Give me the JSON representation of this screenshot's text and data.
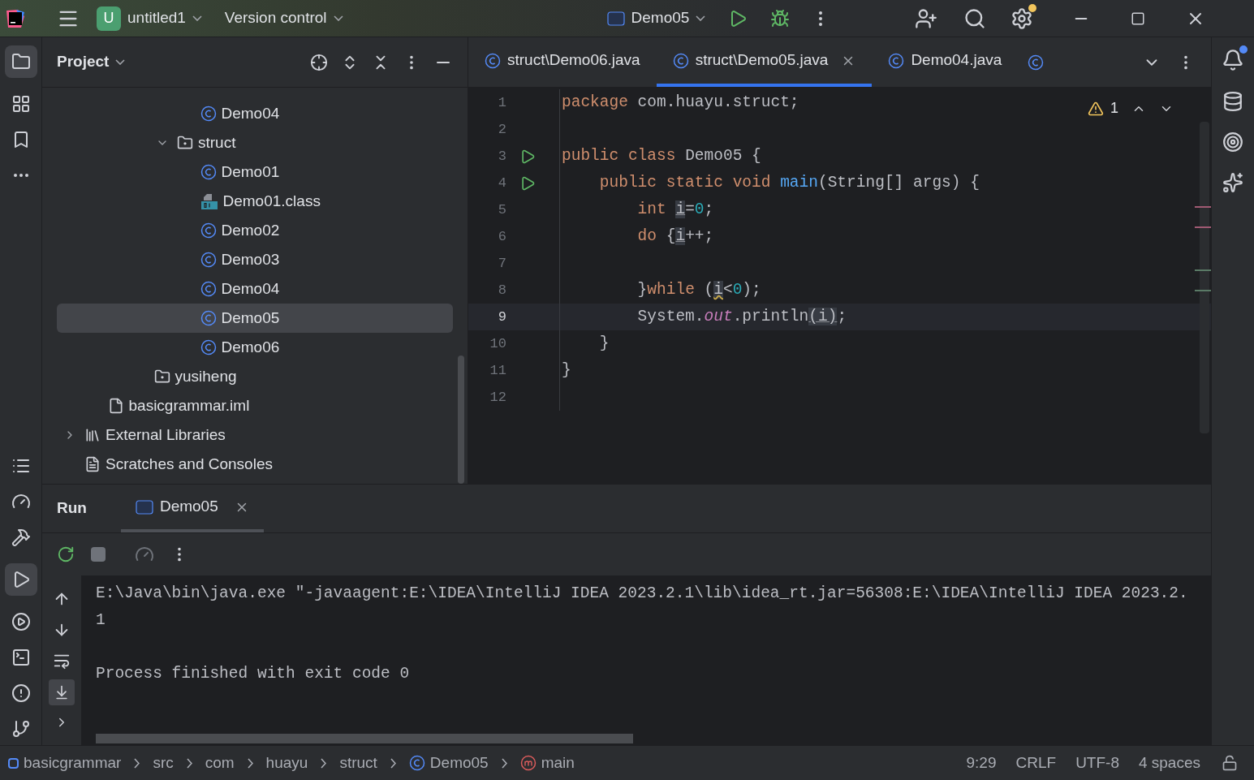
{
  "title_bar": {
    "project_badge": "U",
    "project": "untitled1",
    "vcs": "Version control",
    "run_config": "Demo05"
  },
  "project_panel": {
    "title": "Project",
    "tree": [
      {
        "children": [
          {
            "children": [
              {
                "children": [
                  {
                    "children": [
                      {
                        "children": [
                          {
                            "label": "Demo04",
                            "kind": "class",
                            "selected": false
                          }
                        ]
                      },
                      {
                        "label": "struct",
                        "kind": "package",
                        "expanded": true,
                        "children": [
                          {
                            "label": "Demo01",
                            "kind": "class",
                            "selected": false
                          },
                          {
                            "label": "Demo01.class",
                            "kind": "class-file",
                            "selected": false
                          },
                          {
                            "label": "Demo02",
                            "kind": "class",
                            "selected": false
                          },
                          {
                            "label": "Demo03",
                            "kind": "class",
                            "selected": false
                          },
                          {
                            "label": "Demo04",
                            "kind": "class",
                            "selected": false
                          },
                          {
                            "label": "Demo05",
                            "kind": "class",
                            "selected": true
                          },
                          {
                            "label": "Demo06",
                            "kind": "class",
                            "selected": false
                          }
                        ]
                      }
                    ]
                  },
                  {
                    "label": "yusiheng",
                    "kind": "package"
                  }
                ]
              }
            ]
          },
          {
            "label": "basicgrammar.iml",
            "kind": "module-file"
          }
        ]
      },
      {
        "label": "External Libraries",
        "kind": "libraries",
        "expanded": false
      },
      {
        "label": "Scratches and Consoles",
        "kind": "scratches"
      }
    ]
  },
  "editor": {
    "tabs": [
      {
        "label": "struct\\Demo06.java",
        "selected": false
      },
      {
        "label": "struct\\Demo05.java",
        "selected": true
      },
      {
        "label": "Demo04.java",
        "selected": false
      }
    ],
    "warnings": "1",
    "lines": [
      {
        "number": "1",
        "current": false,
        "tokens": [
          {
            "kind": "keyword",
            "s": "package"
          },
          {
            "kind": "plain",
            "s": " com.huayu.struct;"
          }
        ]
      },
      {
        "number": "2",
        "current": false
      },
      {
        "number": "3",
        "current": false,
        "runnable": true,
        "tokens": [
          {
            "kind": "keyword",
            "s": "public class"
          },
          {
            "kind": "plain",
            "s": " Demo05 {"
          }
        ]
      },
      {
        "number": "4",
        "current": false,
        "runnable": true,
        "tokens": [
          {
            "kind": "keyword",
            "s": "    public static void "
          },
          {
            "kind": "method",
            "s": "main"
          },
          {
            "kind": "plain",
            "s": "(String[] args) {"
          }
        ]
      },
      {
        "number": "5",
        "current": false,
        "tokens": [
          {
            "kind": "keyword",
            "s": "        int "
          },
          {
            "kind": "usage",
            "s": "i"
          },
          {
            "kind": "plain",
            "s": "="
          },
          {
            "kind": "number",
            "s": "0"
          },
          {
            "kind": "plain",
            "s": ";"
          }
        ]
      },
      {
        "number": "6",
        "current": false,
        "tokens": [
          {
            "kind": "keyword",
            "s": "        do"
          },
          {
            "kind": "plain",
            "s": " {"
          },
          {
            "kind": "usage",
            "s": "i"
          },
          {
            "kind": "plain",
            "s": "++;"
          }
        ]
      },
      {
        "number": "7",
        "current": false
      },
      {
        "number": "8",
        "current": false,
        "tokens": [
          {
            "kind": "plain",
            "s": "        }"
          },
          {
            "kind": "keyword",
            "s": "while"
          },
          {
            "kind": "plain",
            "s": " ("
          },
          {
            "kind": "warning",
            "s": "i"
          },
          {
            "kind": "plain",
            "s": "<"
          },
          {
            "kind": "number",
            "s": "0"
          },
          {
            "kind": "plain",
            "s": ");"
          }
        ]
      },
      {
        "number": "9",
        "current": true,
        "tokens": [
          {
            "kind": "plain",
            "s": "        System."
          },
          {
            "kind": "field",
            "s": "out"
          },
          {
            "kind": "plain",
            "s": ".println"
          },
          {
            "kind": "usage",
            "s": "(i)"
          },
          {
            "kind": "plain",
            "s": ";"
          }
        ]
      },
      {
        "number": "10",
        "current": false,
        "tokens": [
          {
            "kind": "plain",
            "s": "    }"
          }
        ]
      },
      {
        "number": "11",
        "current": false,
        "tokens": [
          {
            "kind": "plain",
            "s": "}"
          }
        ]
      },
      {
        "number": "12",
        "current": false
      }
    ]
  },
  "run_panel": {
    "title": "Run",
    "tabs": [
      {
        "label": "Demo05",
        "selected": true
      }
    ],
    "output": [
      {
        "kind": "command",
        "text": "E:\\Java\\bin\\java.exe \"-javaagent:E:\\IDEA\\IntelliJ IDEA 2023.2.1\\lib\\idea_rt.jar=56308:E:\\IDEA\\IntelliJ IDEA 2023.2."
      },
      {
        "kind": "stdout",
        "text": "1"
      },
      {
        "kind": "exit",
        "text": "Process finished with exit code 0"
      }
    ]
  },
  "status_bar": {
    "breadcrumbs": [
      {
        "kind": "module",
        "label": "basicgrammar"
      },
      {
        "kind": "folder",
        "label": "src"
      },
      {
        "kind": "folder",
        "label": "com"
      },
      {
        "kind": "folder",
        "label": "huayu"
      },
      {
        "kind": "folder",
        "label": "struct"
      },
      {
        "kind": "class",
        "label": "Demo05"
      },
      {
        "kind": "method",
        "label": "main"
      }
    ],
    "items": [
      "9:29",
      "CRLF",
      "UTF-8",
      "4 spaces"
    ]
  }
}
